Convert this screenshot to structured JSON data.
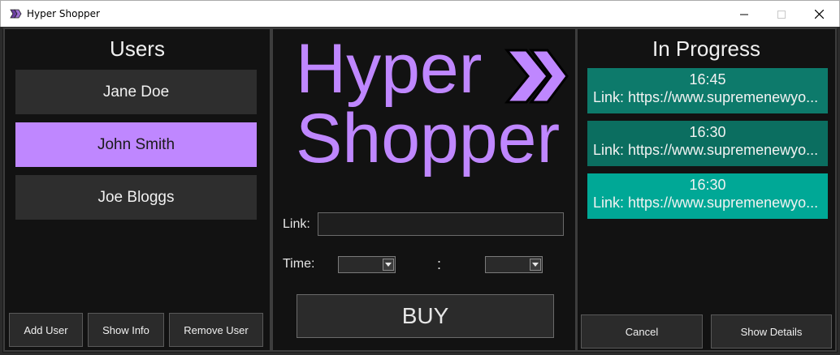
{
  "window": {
    "title": "Hyper Shopper",
    "controls": [
      "minimize",
      "maximize",
      "close"
    ]
  },
  "users_panel": {
    "heading": "Users",
    "users": [
      {
        "name": "Jane Doe",
        "selected": false
      },
      {
        "name": "John Smith",
        "selected": true
      },
      {
        "name": "Joe Bloggs",
        "selected": false
      }
    ],
    "buttons": {
      "add": "Add User",
      "info": "Show Info",
      "remove": "Remove User"
    }
  },
  "center_panel": {
    "logo": {
      "line1": "Hyper",
      "line2": "Shopper",
      "icon": "double-chevron-right-icon"
    },
    "link_label": "Link:",
    "link_value": "",
    "time_label": "Time:",
    "hour_value": "",
    "minute_value": "",
    "time_separator": ":",
    "buy_label": "BUY"
  },
  "progress_panel": {
    "heading": "In Progress",
    "tasks": [
      {
        "time": "16:45",
        "link": "Link: https://www.supremenewyo...",
        "color": "#0d7a6b"
      },
      {
        "time": "16:30",
        "link": "Link: https://www.supremenewyo...",
        "color": "#0b6e60"
      },
      {
        "time": "16:30",
        "link": "Link: https://www.supremenewyo...",
        "color": "#00a896"
      }
    ],
    "buttons": {
      "cancel": "Cancel",
      "details": "Show Details"
    }
  },
  "colors": {
    "accent": "#bf87ff",
    "background": "#121212",
    "button": "#2e2e2e"
  }
}
